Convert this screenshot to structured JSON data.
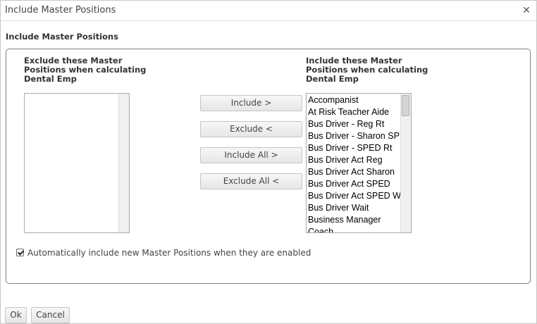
{
  "dialog": {
    "title": "Include Master Positions"
  },
  "section": {
    "heading": "Include Master Positions"
  },
  "exclude_list": {
    "label_lines": [
      "Exclude these Master",
      "Positions when calculating",
      "Dental Emp"
    ],
    "items": []
  },
  "include_list": {
    "label_lines": [
      "Include these Master",
      "Positions when calculating",
      "Dental Emp"
    ],
    "items": [
      "Accompanist",
      "At Risk Teacher Aide",
      "Bus Driver - Reg Rt",
      "Bus Driver - Sharon SP",
      "Bus Driver - SPED Rt",
      "Bus Driver Act Reg",
      "Bus Driver Act Sharon",
      "Bus Driver Act SPED",
      "Bus Driver Act SPED W",
      "Bus Driver Wait",
      "Business Manager",
      "Coach"
    ]
  },
  "buttons": {
    "include": "Include >",
    "exclude": "Exclude <",
    "include_all": "Include All >",
    "exclude_all": "Exclude All <"
  },
  "auto_include": {
    "label": "Automatically include new Master Positions when they are enabled",
    "checked": true
  },
  "footer": {
    "ok": "Ok",
    "cancel": "Cancel"
  }
}
